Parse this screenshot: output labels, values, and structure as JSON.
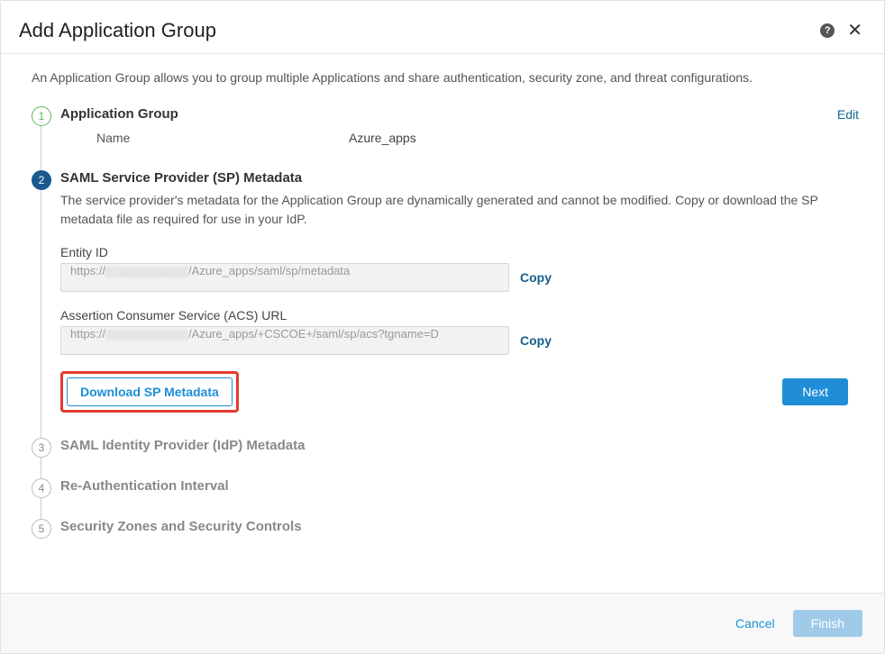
{
  "header": {
    "title": "Add Application Group"
  },
  "intro": "An Application Group allows you to group multiple Applications and share authentication, security zone, and threat configurations.",
  "steps": {
    "s1": {
      "num": "1",
      "title": "Application Group",
      "edit": "Edit",
      "name_label": "Name",
      "name_value": "Azure_apps"
    },
    "s2": {
      "num": "2",
      "title": "SAML Service Provider (SP) Metadata",
      "desc": "The service provider's metadata for the Application Group are dynamically generated and cannot be modified. Copy or download the SP metadata file as required for use in your IdP.",
      "entity_label": "Entity ID",
      "entity_prefix": "https://",
      "entity_suffix": "/Azure_apps/saml/sp/metadata",
      "acs_label": "Assertion Consumer Service (ACS) URL",
      "acs_prefix": "https://",
      "acs_suffix": "/Azure_apps/+CSCOE+/saml/sp/acs?tgname=D",
      "copy": "Copy",
      "download": "Download SP Metadata",
      "next": "Next"
    },
    "s3": {
      "num": "3",
      "title": "SAML Identity Provider (IdP) Metadata"
    },
    "s4": {
      "num": "4",
      "title": "Re-Authentication Interval"
    },
    "s5": {
      "num": "5",
      "title": "Security Zones and Security Controls"
    }
  },
  "footer": {
    "cancel": "Cancel",
    "finish": "Finish"
  }
}
